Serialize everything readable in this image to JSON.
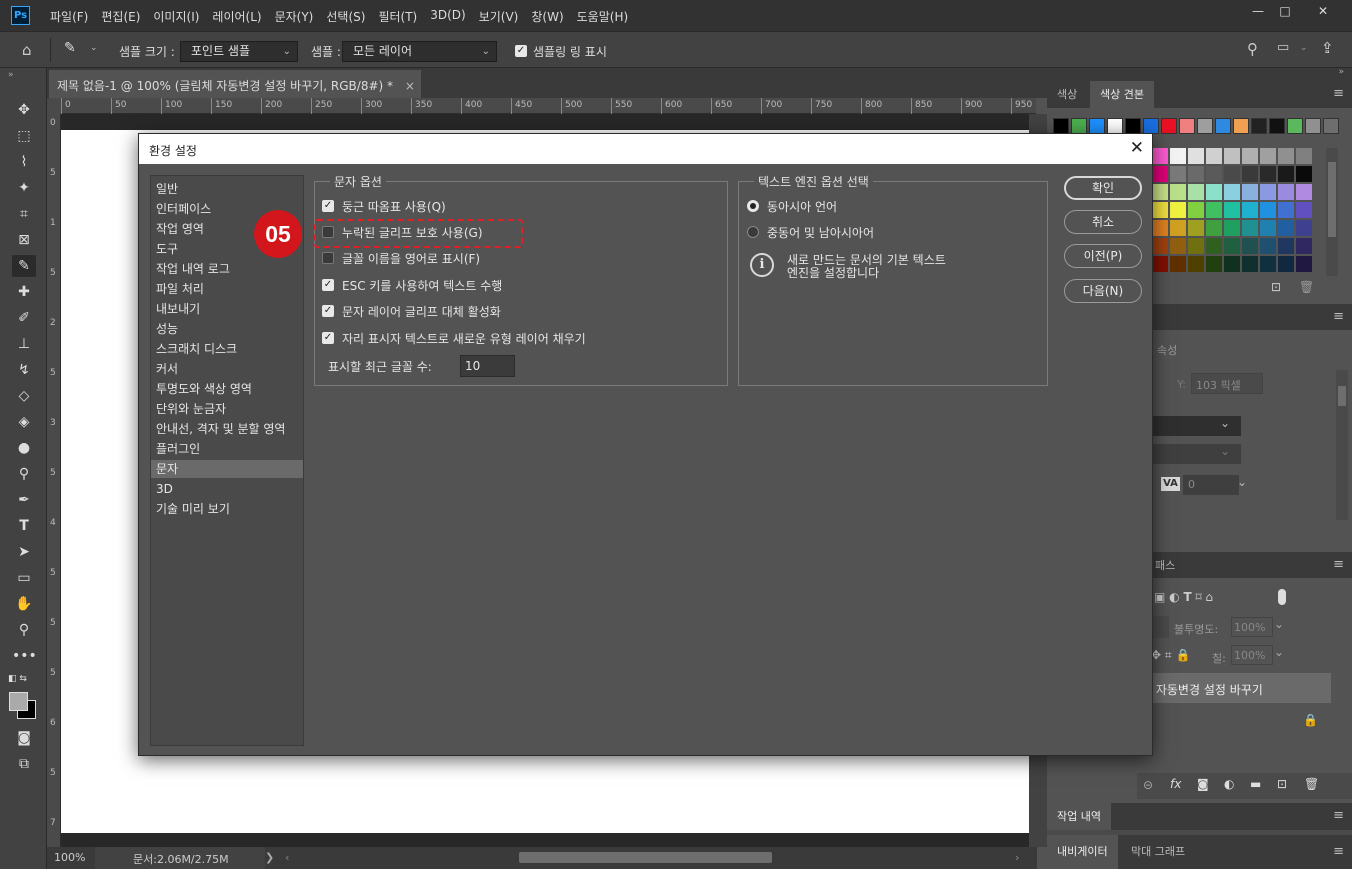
{
  "app": {
    "logo": "Ps"
  },
  "menu": [
    "파일(F)",
    "편집(E)",
    "이미지(I)",
    "레이어(L)",
    "문자(Y)",
    "선택(S)",
    "필터(T)",
    "3D(D)",
    "보기(V)",
    "창(W)",
    "도움말(H)"
  ],
  "window_controls": {
    "minimize": "—",
    "maximize": "□",
    "close": "✕"
  },
  "options_bar": {
    "sample_size_label": "샘플 크기 :",
    "sample_size_value": "포인트 샘플",
    "sample_label": "샘플 :",
    "sample_value": "모든 레이어",
    "show_sampling_ring_label": "샘플링 링 표시",
    "show_sampling_ring_checked": true
  },
  "document": {
    "tab_title": "제목 없음-1 @ 100% (글림체 자동변경 설정 바꾸기, RGB/8#) *",
    "tab_close": "×",
    "ruler_h_labels": [
      "0",
      "50",
      "100",
      "150",
      "200",
      "250",
      "300",
      "350",
      "400",
      "450",
      "500",
      "550",
      "600",
      "650",
      "700",
      "750",
      "800",
      "850",
      "900",
      "950"
    ],
    "ruler_v_labels": [
      "0",
      "5",
      "1",
      "5",
      "2",
      "5",
      "3",
      "5",
      "4",
      "5",
      "5",
      "5",
      "6",
      "5",
      "7"
    ],
    "zoom": "100%",
    "doc_size": "문서:2.06M/2.75M",
    "status_arrow": "❯"
  },
  "right_panel": {
    "swatches_tabs": [
      "색상",
      "색상 견본"
    ],
    "properties_tab": "속성",
    "y_field": "Y:",
    "y_value": "103 픽셀",
    "va_label": "VA",
    "va_value": "0",
    "paths_tab": "패스",
    "opacity_label": "불투명도:",
    "opacity_value": "100%",
    "fill_label": "칠:",
    "fill_value": "100%",
    "layer_name": "체 자동변경 설정 바꾸기",
    "history_tab": "작업 내역",
    "bottom_tabs": [
      "내비게이터",
      "막대 그래프"
    ],
    "layer_footer_icons": [
      "link-icon",
      "fx-icon",
      "mask-icon",
      "adjustment-icon",
      "folder-icon",
      "new-layer-icon",
      "trash-icon"
    ],
    "fx_label": "fx",
    "swatch_colors_row1": [
      "#000000",
      "#4caf50",
      "#1e90ff",
      "#ffffff",
      "#000000",
      "#1a6fe0",
      "#e81123",
      "#f08080",
      "#9e9e9e",
      "#2d8ae0",
      "#f0a050",
      "#222222",
      "#111111",
      "#5cb85c",
      "#909090",
      "#6e6e6e"
    ]
  },
  "dialog": {
    "title": "환경 설정",
    "close": "✕",
    "categories": [
      "일반",
      "인터페이스",
      "작업 영역",
      "도구",
      "작업 내역 로그",
      "파일 처리",
      "내보내기",
      "성능",
      "스크래치 디스크",
      "커서",
      "투명도와 색상 영역",
      "단위와 눈금자",
      "안내선, 격자 및 분할 영역",
      "플러그인",
      "문자",
      "3D",
      "기술 미리 보기"
    ],
    "selected_category": "문자",
    "type_options": {
      "legend": "문자 옵션",
      "items": [
        {
          "label": "둥근 따옴표 사용(Q)",
          "checked": true
        },
        {
          "label": "누락된 글리프 보호 사용(G)",
          "checked": false
        },
        {
          "label": "글꼴 이름을 영어로 표시(F)",
          "checked": false
        },
        {
          "label": "ESC 키를 사용하여 텍스트 수행",
          "checked": true
        },
        {
          "label": "문자 레이어 글리프 대체 활성화",
          "checked": true
        },
        {
          "label": "자리 표시자 텍스트로 새로운 유형 레이어 채우기",
          "checked": true
        }
      ],
      "recent_fonts_label": "표시할 최근 글꼴 수:",
      "recent_fonts_value": "10"
    },
    "text_engine": {
      "legend": "텍스트 엔진 옵션 선택",
      "options": [
        {
          "label": "동아시아 언어",
          "selected": true
        },
        {
          "label": "중동어 및 남아시아어",
          "selected": false
        }
      ],
      "info_icon": "i",
      "info_text_line1": "새로 만드는 문서의 기본 텍스트",
      "info_text_line2": "엔진을 설정합니다"
    },
    "buttons": {
      "ok": "확인",
      "cancel": "취소",
      "prev": "이전(P)",
      "next": "다음(N)"
    },
    "step_badge": "05"
  }
}
